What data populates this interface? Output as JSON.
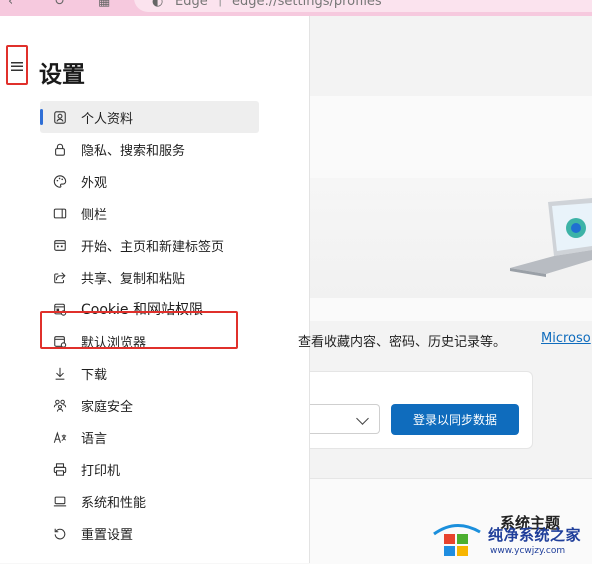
{
  "browser": {
    "app_name": "Edge",
    "separator": "|",
    "url": "edge://settings/profiles"
  },
  "sidebar": {
    "title": "设置",
    "items": [
      {
        "label": "个人资料",
        "icon": "profile-icon",
        "active": true
      },
      {
        "label": "隐私、搜索和服务",
        "icon": "lock-icon"
      },
      {
        "label": "外观",
        "icon": "palette-icon"
      },
      {
        "label": "侧栏",
        "icon": "sidebar-icon"
      },
      {
        "label": "开始、主页和新建标签页",
        "icon": "home-tab-icon"
      },
      {
        "label": "共享、复制和粘贴",
        "icon": "share-icon"
      },
      {
        "label": "Cookie 和网站权限",
        "icon": "site-permissions-icon",
        "highlighted": true
      },
      {
        "label": "默认浏览器",
        "icon": "browser-icon"
      },
      {
        "label": "下载",
        "icon": "download-icon"
      },
      {
        "label": "家庭安全",
        "icon": "family-icon"
      },
      {
        "label": "语言",
        "icon": "language-icon"
      },
      {
        "label": "打印机",
        "icon": "printer-icon"
      },
      {
        "label": "系统和性能",
        "icon": "laptop-icon"
      },
      {
        "label": "重置设置",
        "icon": "reset-icon"
      }
    ]
  },
  "main": {
    "sync_description": "查看收藏内容、密码、历史记录等。",
    "sync_link": "Microso",
    "sync_button": "登录以同步数据",
    "section_title_partial": "系统主题"
  },
  "watermark": {
    "name": "纯净系统之家",
    "url": "www.ycwjzy.com"
  },
  "colors": {
    "accent": "#0f6cbd",
    "highlight_box": "#e0302b",
    "chrome": "#f6c9de"
  }
}
